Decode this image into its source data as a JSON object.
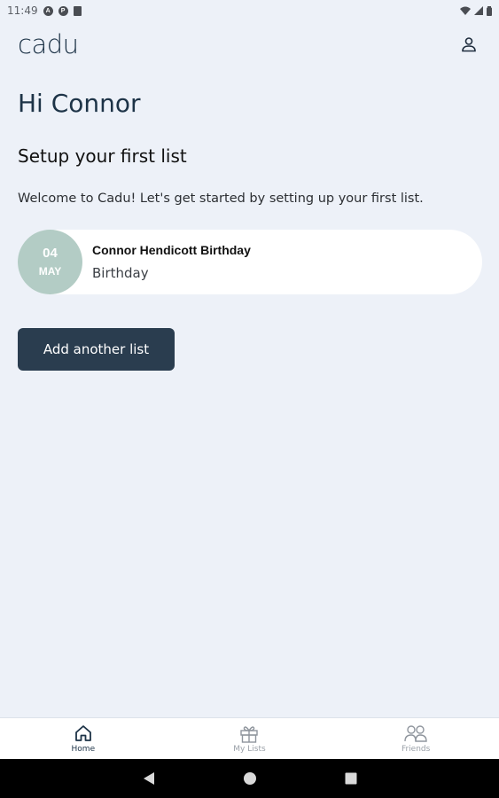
{
  "status_bar": {
    "time": "11:49"
  },
  "header": {
    "logo": "cadu"
  },
  "greeting": "Hi Connor",
  "section_title": "Setup your first list",
  "welcome_text": "Welcome to Cadu! Let's get started by setting up your first list.",
  "list_card": {
    "day": "04",
    "month": "MAY",
    "title": "Connor Hendicott Birthday",
    "subtitle": "Birthday"
  },
  "add_button_label": "Add another list",
  "bottom_nav": {
    "items": [
      {
        "label": "Home",
        "icon": "home-icon",
        "active": true
      },
      {
        "label": "My Lists",
        "icon": "gift-icon",
        "active": false
      },
      {
        "label": "Friends",
        "icon": "friends-icon",
        "active": false
      }
    ]
  },
  "colors": {
    "background": "#edf1f8",
    "primary": "#2a3d4f",
    "date_badge": "#b3ccc5"
  }
}
